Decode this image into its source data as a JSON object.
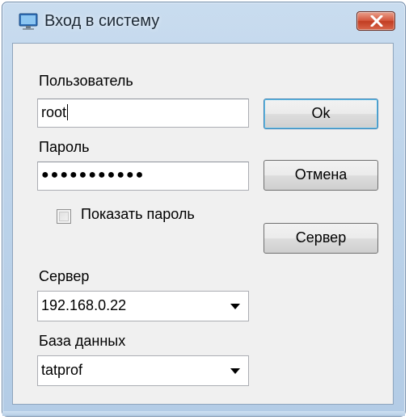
{
  "window": {
    "title": "Вход в систему",
    "icon": "computer-icon",
    "close_icon": "close-icon"
  },
  "form": {
    "user_label": "Пользователь",
    "user_value": "root",
    "password_label": "Пароль",
    "password_mask": "●●●●●●●●●●●",
    "show_password_label": "Показать пароль",
    "show_password_checked": false,
    "server_label": "Сервер",
    "server_value": "192.168.0.22",
    "database_label": "База данных",
    "database_value": "tatprof"
  },
  "buttons": {
    "ok": "Ok",
    "cancel": "Отмена",
    "server": "Сервер"
  },
  "colors": {
    "accent": "#3c7fb1",
    "close": "#c8432a",
    "frame": "#bcd3ea"
  }
}
